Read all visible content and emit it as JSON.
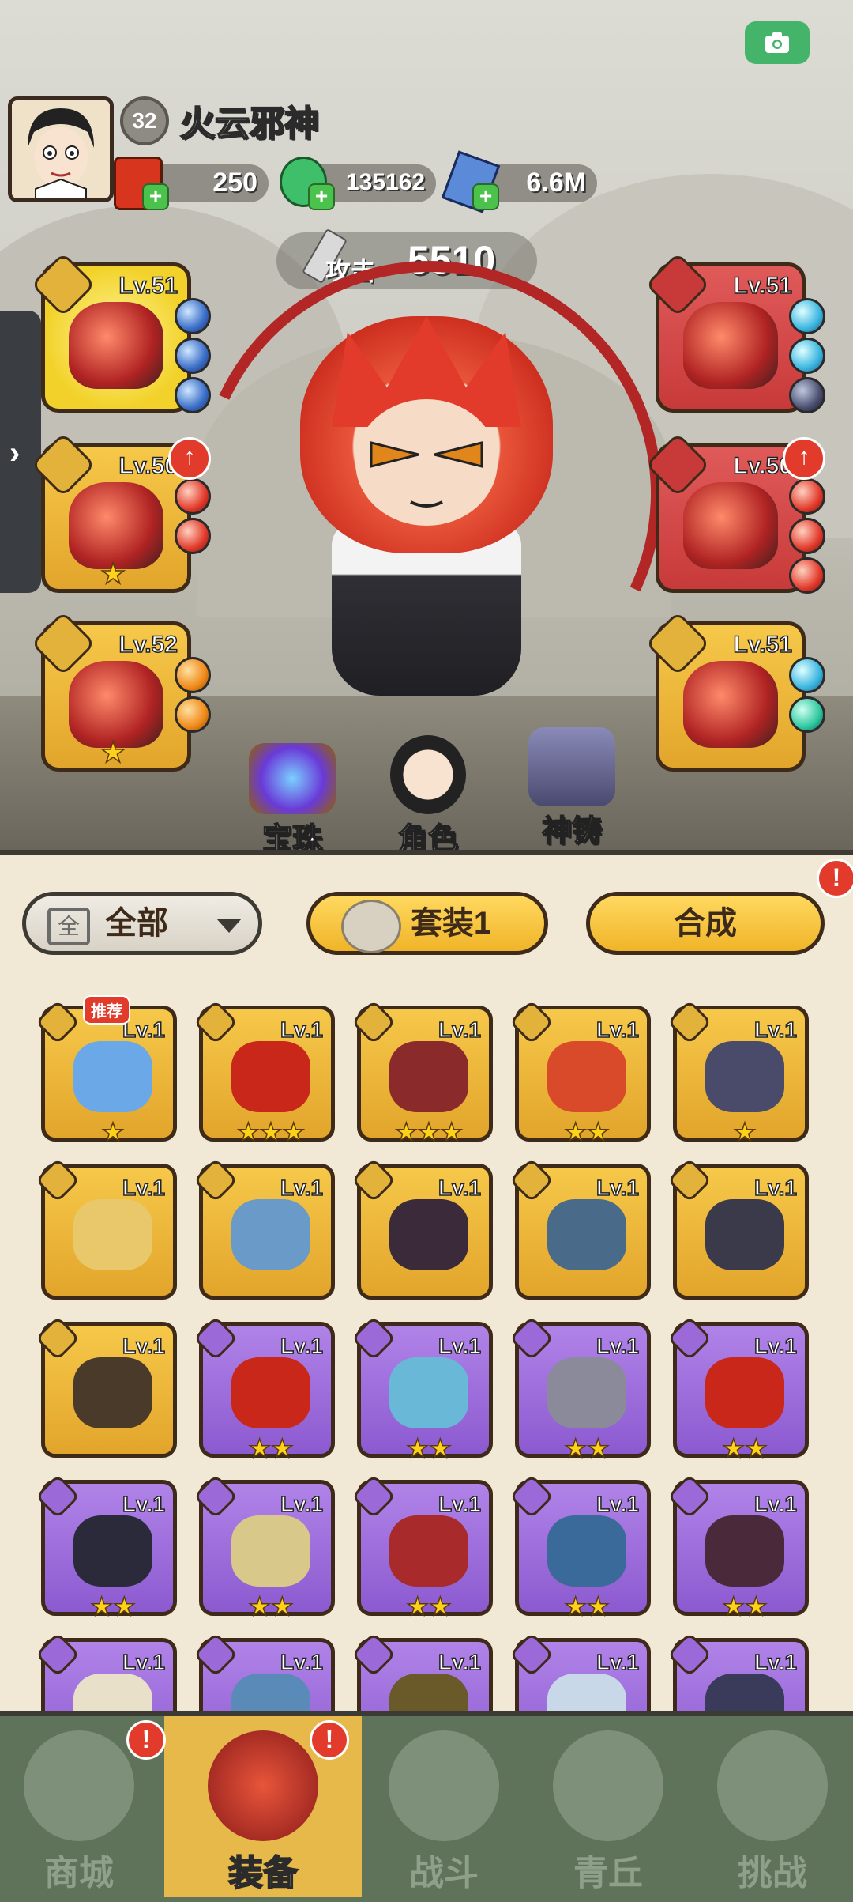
{
  "player": {
    "level": "32",
    "name": "火云邪神"
  },
  "resources": [
    {
      "name": "red-envelope",
      "value": "250"
    },
    {
      "name": "jade-dragon",
      "value": "135162"
    },
    {
      "name": "crystal",
      "value": "6.6M"
    }
  ],
  "power": {
    "label": "攻击",
    "value": "5510"
  },
  "left_slots": [
    {
      "level": "Lv.51",
      "quality": "gold-hi",
      "gems": [
        "blue",
        "blue",
        "blue"
      ],
      "stars": 0,
      "upgrade": false
    },
    {
      "level": "Lv.50",
      "quality": "gold",
      "gems": [
        "red",
        "red"
      ],
      "stars": 1,
      "upgrade": true
    },
    {
      "level": "Lv.52",
      "quality": "gold",
      "gems": [
        "orange",
        "orange"
      ],
      "stars": 1,
      "upgrade": false
    }
  ],
  "right_slots": [
    {
      "level": "Lv.51",
      "quality": "red",
      "gems": [
        "cyan",
        "cyan",
        "dark"
      ],
      "stars": 0,
      "upgrade": false
    },
    {
      "level": "Lv.50",
      "quality": "red",
      "gems": [
        "red",
        "red",
        "red"
      ],
      "stars": 0,
      "upgrade": true
    },
    {
      "level": "Lv.51",
      "quality": "gold",
      "gems": [
        "cyan",
        "teal"
      ],
      "stars": 0,
      "upgrade": false
    }
  ],
  "hero_buttons": {
    "gems": "宝珠",
    "character": "角色",
    "forge": "神铸"
  },
  "filter": {
    "icon_char": "全",
    "label": "全部"
  },
  "set_button": {
    "label": "套装1"
  },
  "craft_button": {
    "label": "合成"
  },
  "recommend_tag": "推荐",
  "inventory": [
    {
      "level": "Lv.1",
      "quality": "gold",
      "stars": 1,
      "recommend": true,
      "color": "#6aa8e8"
    },
    {
      "level": "Lv.1",
      "quality": "gold",
      "stars": 3,
      "recommend": false,
      "color": "#c8271a"
    },
    {
      "level": "Lv.1",
      "quality": "gold",
      "stars": 3,
      "recommend": false,
      "color": "#8a2a2a"
    },
    {
      "level": "Lv.1",
      "quality": "gold",
      "stars": 2,
      "recommend": false,
      "color": "#d84a2a"
    },
    {
      "level": "Lv.1",
      "quality": "gold",
      "stars": 1,
      "recommend": false,
      "color": "#4a4a6a"
    },
    {
      "level": "Lv.1",
      "quality": "gold",
      "stars": 0,
      "recommend": false,
      "color": "#e8c86a"
    },
    {
      "level": "Lv.1",
      "quality": "gold",
      "stars": 0,
      "recommend": false,
      "color": "#6a9ac8"
    },
    {
      "level": "Lv.1",
      "quality": "gold",
      "stars": 0,
      "recommend": false,
      "color": "#3a2a3a"
    },
    {
      "level": "Lv.1",
      "quality": "gold",
      "stars": 0,
      "recommend": false,
      "color": "#4a6a8a"
    },
    {
      "level": "Lv.1",
      "quality": "gold",
      "stars": 0,
      "recommend": false,
      "color": "#3a3a4a"
    },
    {
      "level": "Lv.1",
      "quality": "gold",
      "stars": 0,
      "recommend": false,
      "color": "#4a3a2a"
    },
    {
      "level": "Lv.1",
      "quality": "purple",
      "stars": 2,
      "recommend": false,
      "color": "#c8271a"
    },
    {
      "level": "Lv.1",
      "quality": "purple",
      "stars": 2,
      "recommend": false,
      "color": "#6ab8d8"
    },
    {
      "level": "Lv.1",
      "quality": "purple",
      "stars": 2,
      "recommend": false,
      "color": "#8a8a9a"
    },
    {
      "level": "Lv.1",
      "quality": "purple",
      "stars": 2,
      "recommend": false,
      "color": "#c8271a"
    },
    {
      "level": "Lv.1",
      "quality": "purple",
      "stars": 2,
      "recommend": false,
      "color": "#2a2a3a"
    },
    {
      "level": "Lv.1",
      "quality": "purple",
      "stars": 2,
      "recommend": false,
      "color": "#d8c88a"
    },
    {
      "level": "Lv.1",
      "quality": "purple",
      "stars": 2,
      "recommend": false,
      "color": "#a82a2a"
    },
    {
      "level": "Lv.1",
      "quality": "purple",
      "stars": 2,
      "recommend": false,
      "color": "#3a6a9a"
    },
    {
      "level": "Lv.1",
      "quality": "purple",
      "stars": 2,
      "recommend": false,
      "color": "#4a2a3a"
    },
    {
      "level": "Lv.1",
      "quality": "purple",
      "stars": 0,
      "recommend": false,
      "color": "#e8e0c8"
    },
    {
      "level": "Lv.1",
      "quality": "purple",
      "stars": 0,
      "recommend": false,
      "color": "#5a8ab8"
    },
    {
      "level": "Lv.1",
      "quality": "purple",
      "stars": 0,
      "recommend": false,
      "color": "#6a5a2a"
    },
    {
      "level": "Lv.1",
      "quality": "purple",
      "stars": 0,
      "recommend": false,
      "color": "#c8d8e8"
    },
    {
      "level": "Lv.1",
      "quality": "purple",
      "stars": 0,
      "recommend": false,
      "color": "#3a3a5a"
    }
  ],
  "nav": [
    {
      "label": "商城",
      "alert": true,
      "active": false
    },
    {
      "label": "装备",
      "alert": true,
      "active": true
    },
    {
      "label": "战斗",
      "alert": false,
      "active": false
    },
    {
      "label": "青丘",
      "alert": false,
      "active": false
    },
    {
      "label": "挑战",
      "alert": false,
      "active": false
    }
  ]
}
